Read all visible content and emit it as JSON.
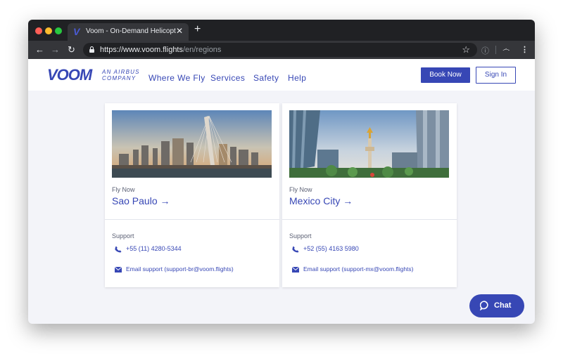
{
  "browser": {
    "tab_title": "Voom - On-Demand Helicopter",
    "tab_close": "✕",
    "new_tab": "+",
    "url_host": "https://www.voom.flights",
    "url_path": "/en/regions",
    "icons": {
      "back": "arrow-left-icon",
      "forward": "arrow-right-icon",
      "reload": "reload-icon",
      "lock": "lock-icon",
      "star": "star-icon",
      "menu": "kebab-menu-icon"
    }
  },
  "header": {
    "logo": "VOOM",
    "tagline_1": "AN AIRBUS",
    "tagline_2": "COMPANY",
    "nav": [
      "Where We Fly",
      "Services",
      "Safety",
      "Help"
    ],
    "book_now": "Book Now",
    "sign_in": "Sign In",
    "accent_color": "#3747b5"
  },
  "regions": [
    {
      "fly_now": "Fly Now",
      "city": "Sao Paulo",
      "arrow": "→",
      "support_label": "Support",
      "phone": "+55 (11) 4280-5344",
      "email": "Email support (support-br@voom.flights)"
    },
    {
      "fly_now": "Fly Now",
      "city": "Mexico City",
      "arrow": "→",
      "support_label": "Support",
      "phone": "+52 (55) 4163 5980",
      "email": "Email support (support-mx@voom.flights)"
    }
  ],
  "chat": {
    "label": "Chat"
  }
}
